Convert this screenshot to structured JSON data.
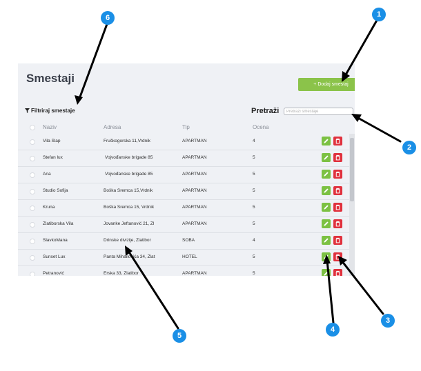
{
  "page": {
    "title": "Smestaji"
  },
  "toolbar": {
    "add_label": "+ Dodaj smestaj"
  },
  "filter": {
    "label": "Filtriraj smestaje",
    "icon": "funnel-icon"
  },
  "search": {
    "label": "Pretraži",
    "placeholder": "Pretraži smestaje"
  },
  "table": {
    "columns": [
      "Naziv",
      "Adresa",
      "Tip",
      "Ocena"
    ],
    "rows": [
      {
        "naziv": "Vila Slap",
        "adresa": "Fruškogorska 11,Vrdnik",
        "tip": "APARTMAN",
        "ocena": "4"
      },
      {
        "naziv": "Stefan lux",
        "adresa": "Vojvođanske brigade 85",
        "tip": "APARTMAN",
        "ocena": "5"
      },
      {
        "naziv": "Ana",
        "adresa": "Vojvođanske brigade 85",
        "tip": "APARTMAN",
        "ocena": "5"
      },
      {
        "naziv": "Studio Sofija",
        "adresa": "Boška Sremca 15,Vrdnik",
        "tip": "APARTMAN",
        "ocena": "5"
      },
      {
        "naziv": "Kruna",
        "adresa": "Boška Sremca 15, Vrdnik",
        "tip": "APARTMAN",
        "ocena": "5"
      },
      {
        "naziv": "Zlatiborska Vila",
        "adresa": "Jovanke Jeftanović 21, Zl",
        "tip": "APARTMAN",
        "ocena": "5"
      },
      {
        "naziv": "SlavkoMana",
        "adresa": "Drinske divizije, Zlatibor",
        "tip": "SOBA",
        "ocena": "4"
      },
      {
        "naziv": "Sunset Lux",
        "adresa": "Panta Mihailovića 34, Zlat",
        "tip": "HOTEL",
        "ocena": "5"
      },
      {
        "naziv": "Petranović",
        "adresa": "Erska 33, Zlatibor",
        "tip": "APARTMAN",
        "ocena": "5"
      }
    ],
    "row_actions": {
      "edit_icon": "pencil-icon",
      "delete_icon": "trash-icon"
    }
  },
  "annotations": [
    "1",
    "2",
    "3",
    "4",
    "5",
    "6"
  ],
  "colors": {
    "panel_bg": "#eff1f5",
    "add_button": "#8bc34a",
    "edit_button": "#7cc142",
    "delete_button": "#e0313d",
    "annotation_badge": "#1a8fe6",
    "annotation_arrow": "#000000"
  }
}
